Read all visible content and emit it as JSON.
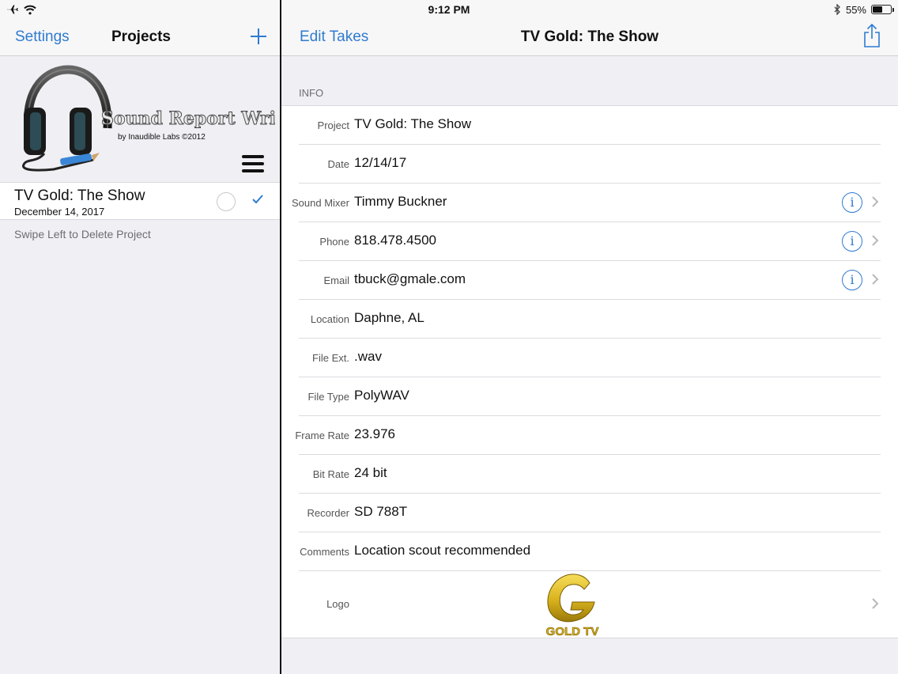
{
  "status_bar": {
    "time": "9:12 PM",
    "battery_percent": "55%",
    "battery_level": 0.55
  },
  "left_nav": {
    "settings_label": "Settings",
    "title": "Projects",
    "add_icon": "plus-icon"
  },
  "right_nav": {
    "edit_label": "Edit Takes",
    "title": "TV Gold: The Show",
    "share_icon": "share-icon"
  },
  "app_logo": {
    "title": "Sound Report Writer",
    "subtitle": "by Inaudible Labs ©2012"
  },
  "project": {
    "name": "TV Gold: The Show",
    "date": "December 14, 2017"
  },
  "swipe_hint": "Swipe Left to Delete Project",
  "info_section": "INFO",
  "fields": [
    {
      "label": "Project",
      "value": "TV Gold: The Show"
    },
    {
      "label": "Date",
      "value": "12/14/17"
    },
    {
      "label": "Sound Mixer",
      "value": "Timmy Buckner"
    },
    {
      "label": "Phone",
      "value": "818.478.4500"
    },
    {
      "label": "Email",
      "value": "tbuck@gmale.com"
    },
    {
      "label": "Location",
      "value": "Daphne, AL"
    },
    {
      "label": "File Ext.",
      "value": ".wav"
    },
    {
      "label": "File Type",
      "value": "PolyWAV"
    },
    {
      "label": "Frame Rate",
      "value": "23.976"
    },
    {
      "label": "Bit Rate",
      "value": "24 bit"
    },
    {
      "label": "Recorder",
      "value": "SD 788T"
    },
    {
      "label": "Comments",
      "value": "Location scout recommended"
    }
  ],
  "logo_field": {
    "label": "Logo",
    "logo_text": "GOLD TV"
  },
  "colors": {
    "accent": "#2f7bd0",
    "gold": "#d8b21c"
  }
}
